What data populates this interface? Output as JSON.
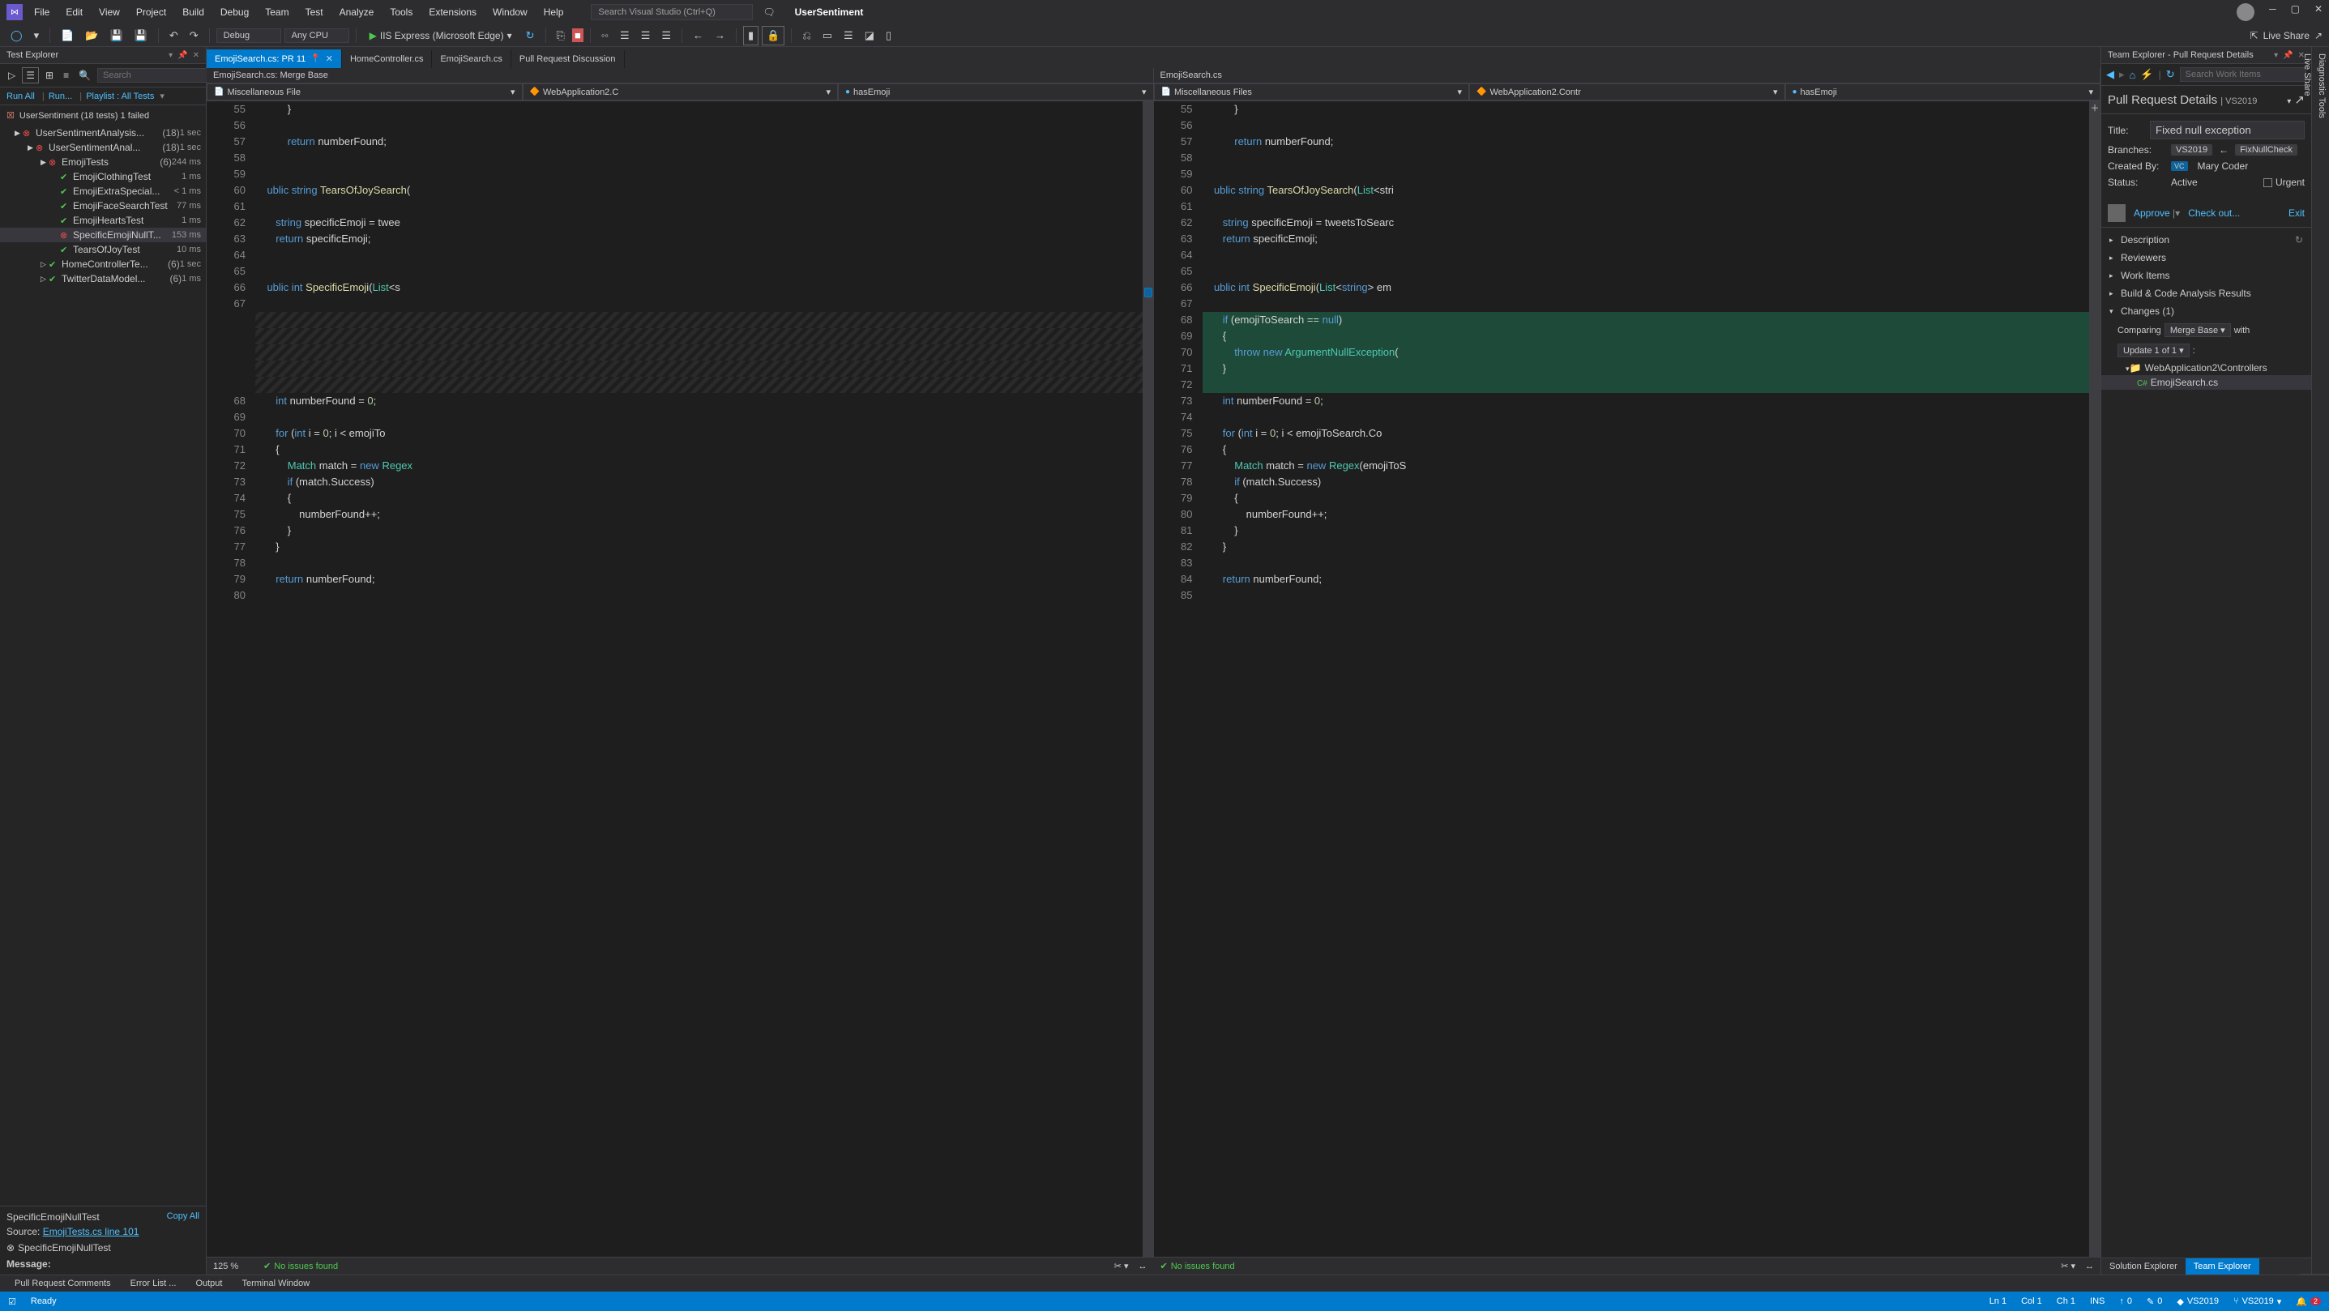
{
  "titlebar": {
    "menu": [
      "File",
      "Edit",
      "View",
      "Project",
      "Build",
      "Debug",
      "Team",
      "Test",
      "Analyze",
      "Tools",
      "Extensions",
      "Window",
      "Help"
    ],
    "search_placeholder": "Search Visual Studio (Ctrl+Q)",
    "solution_name": "UserSentiment"
  },
  "toolbar": {
    "config": "Debug",
    "platform": "Any CPU",
    "run_label": "IIS Express (Microsoft Edge)",
    "live_share": "Live Share"
  },
  "test_explorer": {
    "title": "Test Explorer",
    "search_placeholder": "Search",
    "links": {
      "run_all": "Run All",
      "run": "Run...",
      "playlist": "Playlist : All Tests"
    },
    "summary": "UserSentiment (18 tests) 1 failed",
    "tree": [
      {
        "lvl": 1,
        "chev": "▶",
        "status": "fail",
        "name": "UserSentimentAnalysis...",
        "count": "(18)",
        "time": "1 sec"
      },
      {
        "lvl": 2,
        "chev": "▶",
        "status": "fail",
        "name": "UserSentimentAnal...",
        "count": "(18)",
        "time": "1 sec"
      },
      {
        "lvl": 3,
        "chev": "▶",
        "status": "fail",
        "name": "EmojiTests",
        "count": "(6)",
        "time": "244 ms"
      },
      {
        "lvl": 4,
        "chev": "",
        "status": "pass",
        "name": "EmojiClothingTest",
        "count": "",
        "time": "1 ms"
      },
      {
        "lvl": 4,
        "chev": "",
        "status": "pass",
        "name": "EmojiExtraSpecial...",
        "count": "",
        "time": "< 1 ms"
      },
      {
        "lvl": 4,
        "chev": "",
        "status": "pass",
        "name": "EmojiFaceSearchTest",
        "count": "",
        "time": "77 ms"
      },
      {
        "lvl": 4,
        "chev": "",
        "status": "pass",
        "name": "EmojiHeartsTest",
        "count": "",
        "time": "1 ms"
      },
      {
        "lvl": 4,
        "chev": "",
        "status": "fail",
        "name": "SpecificEmojiNullT...",
        "count": "",
        "time": "153 ms",
        "selected": true
      },
      {
        "lvl": 4,
        "chev": "",
        "status": "pass",
        "name": "TearsOfJoyTest",
        "count": "",
        "time": "10 ms"
      },
      {
        "lvl": 3,
        "chev": "▷",
        "status": "pass",
        "name": "HomeControllerTe...",
        "count": "(6)",
        "time": "1 sec"
      },
      {
        "lvl": 3,
        "chev": "▷",
        "status": "pass",
        "name": "TwitterDataModel...",
        "count": "(6)",
        "time": "1 ms"
      }
    ],
    "detail": {
      "title": "SpecificEmojiNullTest",
      "copy": "Copy All",
      "source_label": "Source:",
      "source_link": "EmojiTests.cs line 101",
      "fail_name": "SpecificEmojiNullTest",
      "message_label": "Message:"
    }
  },
  "tabs": [
    {
      "label": "EmojiSearch.cs: PR 11",
      "active": true,
      "pinned": true,
      "closable": true
    },
    {
      "label": "HomeController.cs",
      "active": false
    },
    {
      "label": "EmojiSearch.cs",
      "active": false
    },
    {
      "label": "Pull Request Discussion",
      "active": false
    }
  ],
  "diff_headers": {
    "left": "EmojiSearch.cs: Merge Base",
    "right": "EmojiSearch.cs"
  },
  "nav": {
    "left": {
      "project": "Miscellaneous File",
      "class": "WebApplication2.C",
      "member": "hasEmoji"
    },
    "right": {
      "project": "Miscellaneous Files",
      "class": "WebApplication2.Contr",
      "member": "hasEmoji"
    }
  },
  "code_left": [
    {
      "n": 55,
      "t": "           }"
    },
    {
      "n": 56,
      "t": ""
    },
    {
      "n": 57,
      "t": "           <kw>return</kw> numberFound;"
    },
    {
      "n": 58,
      "t": ""
    },
    {
      "n": 59,
      "t": ""
    },
    {
      "n": 60,
      "t": "    <kw>ublic string</kw> <mth>TearsOfJoySearch</mth>("
    },
    {
      "n": 61,
      "t": ""
    },
    {
      "n": 62,
      "t": "       <kw>string</kw> specificEmoji = twee"
    },
    {
      "n": 63,
      "t": "       <kw>return</kw> specificEmoji;"
    },
    {
      "n": 64,
      "t": ""
    },
    {
      "n": 65,
      "t": ""
    },
    {
      "n": 66,
      "t": "    <kw>ublic int</kw> <mth>SpecificEmoji</mth>(<typ>List</typ>&lt;s"
    },
    {
      "n": 67,
      "t": ""
    },
    {
      "n": null,
      "t": "",
      "removed": true
    },
    {
      "n": null,
      "t": "",
      "removed": true
    },
    {
      "n": null,
      "t": "",
      "removed": true
    },
    {
      "n": null,
      "t": "",
      "removed": true
    },
    {
      "n": null,
      "t": "",
      "removed": true
    },
    {
      "n": 68,
      "t": "       <kw>int</kw> numberFound = <num>0</num>;"
    },
    {
      "n": 69,
      "t": ""
    },
    {
      "n": 70,
      "t": "       <kw>for</kw> (<kw>int</kw> i = <num>0</num>; i &lt; emojiTo"
    },
    {
      "n": 71,
      "t": "       {"
    },
    {
      "n": 72,
      "t": "           <typ>Match</typ> match = <kw>new</kw> <typ>Regex</typ>"
    },
    {
      "n": 73,
      "t": "           <kw>if</kw> (match.Success)"
    },
    {
      "n": 74,
      "t": "           {"
    },
    {
      "n": 75,
      "t": "               numberFound++;"
    },
    {
      "n": 76,
      "t": "           }"
    },
    {
      "n": 77,
      "t": "       }"
    },
    {
      "n": 78,
      "t": ""
    },
    {
      "n": 79,
      "t": "       <kw>return</kw> numberFound;"
    },
    {
      "n": 80,
      "t": ""
    }
  ],
  "code_right": [
    {
      "n": 55,
      "t": "           }"
    },
    {
      "n": 56,
      "t": ""
    },
    {
      "n": 57,
      "t": "           <kw>return</kw> numberFound;"
    },
    {
      "n": 58,
      "t": ""
    },
    {
      "n": 59,
      "t": ""
    },
    {
      "n": 60,
      "t": "    <kw>ublic string</kw> <mth>TearsOfJoySearch</mth>(<typ>List</typ>&lt;stri"
    },
    {
      "n": 61,
      "t": ""
    },
    {
      "n": 62,
      "t": "       <kw>string</kw> specificEmoji = tweetsToSearc"
    },
    {
      "n": 63,
      "t": "       <kw>return</kw> specificEmoji;"
    },
    {
      "n": 64,
      "t": ""
    },
    {
      "n": 65,
      "t": ""
    },
    {
      "n": 66,
      "t": "    <kw>ublic int</kw> <mth>SpecificEmoji</mth>(<typ>List</typ>&lt;<kw>string</kw>&gt; em"
    },
    {
      "n": 67,
      "t": ""
    },
    {
      "n": 68,
      "t": "       <kw>if</kw> (emojiToSearch == <kw>null</kw>)",
      "added": true
    },
    {
      "n": 69,
      "t": "       {",
      "added": true
    },
    {
      "n": 70,
      "t": "           <kw>throw new</kw> <typ>ArgumentNullException</typ>(",
      "added": true
    },
    {
      "n": 71,
      "t": "       }",
      "added": true
    },
    {
      "n": 72,
      "t": "",
      "added": true
    },
    {
      "n": 73,
      "t": "       <kw>int</kw> numberFound = <num>0</num>;"
    },
    {
      "n": 74,
      "t": ""
    },
    {
      "n": 75,
      "t": "       <kw>for</kw> (<kw>int</kw> i = <num>0</num>; i &lt; emojiToSearch.Co"
    },
    {
      "n": 76,
      "t": "       {"
    },
    {
      "n": 77,
      "t": "           <typ>Match</typ> match = <kw>new</kw> <typ>Regex</typ>(emojiToS"
    },
    {
      "n": 78,
      "t": "           <kw>if</kw> (match.Success)"
    },
    {
      "n": 79,
      "t": "           {"
    },
    {
      "n": 80,
      "t": "               numberFound++;"
    },
    {
      "n": 81,
      "t": "           }"
    },
    {
      "n": 82,
      "t": "       }"
    },
    {
      "n": 83,
      "t": ""
    },
    {
      "n": 84,
      "t": "       <kw>return</kw> numberFound;"
    },
    {
      "n": 85,
      "t": ""
    }
  ],
  "editor_footer": {
    "zoom": "125 %",
    "issues": "No issues found"
  },
  "team_explorer": {
    "title": "Team Explorer - Pull Request Details",
    "search_placeholder": "Search Work Items",
    "heading": "Pull Request Details",
    "heading_sub": "VS2019",
    "fields": {
      "title_label": "Title:",
      "title_value": "Fixed null exception",
      "branches_label": "Branches:",
      "branch_target": "VS2019",
      "branch_source": "FixNullCheck",
      "created_by_label": "Created By:",
      "created_by_badge": "VC",
      "created_by_name": "Mary Coder",
      "status_label": "Status:",
      "status_value": "Active",
      "urgent_label": "Urgent"
    },
    "actions": {
      "approve": "Approve",
      "checkout": "Check out...",
      "exit": "Exit"
    },
    "sections": [
      {
        "label": "Description",
        "expanded": false,
        "refresh": true
      },
      {
        "label": "Reviewers",
        "expanded": false
      },
      {
        "label": "Work Items",
        "expanded": false
      },
      {
        "label": "Build & Code Analysis Results",
        "expanded": false
      },
      {
        "label": "Changes (1)",
        "expanded": true
      }
    ],
    "compare": {
      "comparing": "Comparing",
      "base": "Merge Base",
      "with": "with",
      "update": "Update 1 of 1",
      "colon": ":"
    },
    "file_tree": {
      "folder": "WebApplication2\\Controllers",
      "file": "EmojiSearch.cs"
    },
    "bottom_tabs": {
      "solution": "Solution Explorer",
      "team": "Team Explorer"
    }
  },
  "right_rail": {
    "diag": "Diagnostic Tools",
    "live": "Live Share"
  },
  "bottom_tabs_panel": [
    "Pull Request Comments",
    "Error List ...",
    "Output",
    "Terminal Window"
  ],
  "statusbar": {
    "ready": "Ready",
    "ln": "Ln 1",
    "col": "Col 1",
    "ch": "Ch 1",
    "ins": "INS",
    "up": "0",
    "edit": "0",
    "repo": "VS2019",
    "branch": "VS2019",
    "bell": "2"
  }
}
